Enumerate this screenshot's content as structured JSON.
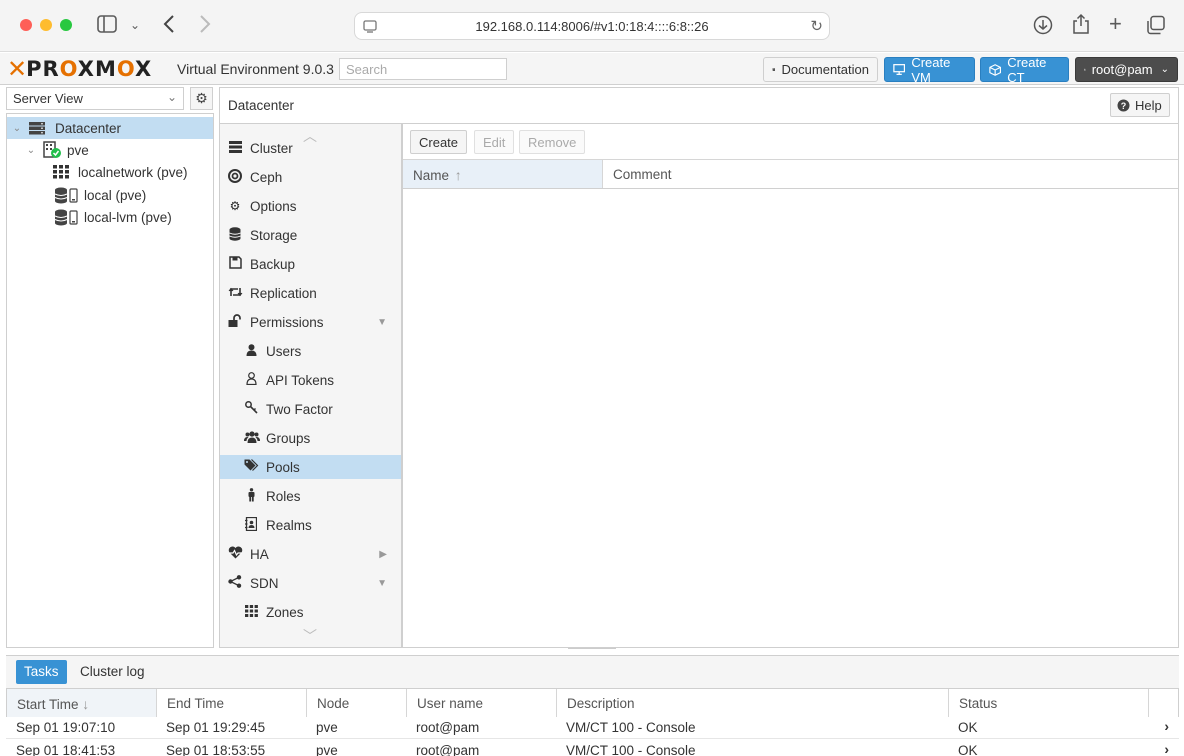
{
  "browser": {
    "url": "192.168.0.114:8006/#v1:0:18:4::::6:8::26"
  },
  "topbar": {
    "product": "PROXMOX",
    "version": "Virtual Environment 9.0.3",
    "search_placeholder": "Search",
    "documentation_label": "Documentation",
    "create_vm_label": "Create VM",
    "create_ct_label": "Create CT",
    "user_label": "root@pam"
  },
  "sidebar": {
    "view": "Server View",
    "tree": [
      {
        "label": "Datacenter",
        "icon": "datacenter-icon"
      },
      {
        "label": "pve",
        "icon": "node-online-icon"
      },
      {
        "label": "localnetwork (pve)",
        "icon": "network-grid-icon"
      },
      {
        "label": "local (pve)",
        "icon": "storage-icon"
      },
      {
        "label": "local-lvm (pve)",
        "icon": "storage-icon"
      }
    ]
  },
  "content": {
    "title": "Datacenter",
    "help_label": "Help"
  },
  "menu": {
    "items": [
      {
        "label": "Cluster",
        "icon": "cluster-icon"
      },
      {
        "label": "Ceph",
        "icon": "ceph-icon"
      },
      {
        "label": "Options",
        "icon": "gear-icon"
      },
      {
        "label": "Storage",
        "icon": "database-icon"
      },
      {
        "label": "Backup",
        "icon": "floppy-icon"
      },
      {
        "label": "Replication",
        "icon": "retweet-icon"
      },
      {
        "label": "Permissions",
        "icon": "unlock-icon"
      },
      {
        "label": "Users",
        "icon": "user-icon"
      },
      {
        "label": "API Tokens",
        "icon": "user-outline-icon"
      },
      {
        "label": "Two Factor",
        "icon": "key-icon"
      },
      {
        "label": "Groups",
        "icon": "users-icon"
      },
      {
        "label": "Pools",
        "icon": "tags-icon"
      },
      {
        "label": "Roles",
        "icon": "male-icon"
      },
      {
        "label": "Realms",
        "icon": "address-book-icon"
      },
      {
        "label": "HA",
        "icon": "heartbeat-icon"
      },
      {
        "label": "SDN",
        "icon": "share-nodes-icon"
      },
      {
        "label": "Zones",
        "icon": "grid-icon"
      }
    ]
  },
  "pools": {
    "create_label": "Create",
    "edit_label": "Edit",
    "remove_label": "Remove",
    "columns": [
      "Name",
      "Comment"
    ]
  },
  "tasks": {
    "tab_tasks": "Tasks",
    "tab_cluster_log": "Cluster log",
    "columns": [
      "Start Time",
      "End Time",
      "Node",
      "User name",
      "Description",
      "Status"
    ],
    "rows": [
      [
        "Sep 01 19:07:10",
        "Sep 01 19:29:45",
        "pve",
        "root@pam",
        "VM/CT 100 - Console",
        "OK"
      ],
      [
        "Sep 01 18:41:53",
        "Sep 01 18:53:55",
        "pve",
        "root@pam",
        "VM/CT 100 - Console",
        "OK"
      ]
    ]
  }
}
